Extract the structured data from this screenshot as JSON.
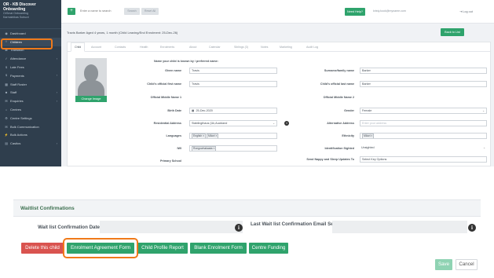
{
  "sidebar": {
    "org_name": "OR - KB Discover Onboarding",
    "org_sub": "OrSmal Onboarding\nKarmalnikas Subscri",
    "items": [
      {
        "icon": "dashboard-icon",
        "glyph": "◉",
        "label": "Dashboard",
        "chevron": ""
      },
      {
        "icon": "children-icon",
        "glyph": "☺",
        "label": "Children",
        "chevron": ""
      },
      {
        "icon": "transition-icon",
        "glyph": "⇄",
        "label": "Transition",
        "chevron": ""
      },
      {
        "icon": "attendance-icon",
        "glyph": "✓",
        "label": "Attendance",
        "chevron": "‹"
      },
      {
        "icon": "late-fees-icon",
        "glyph": "$",
        "label": "Late Fees",
        "chevron": ""
      },
      {
        "icon": "payments-icon",
        "glyph": "$",
        "label": "Payments",
        "chevron": "‹"
      },
      {
        "icon": "staff-roster-icon",
        "glyph": "▦",
        "label": "Staff Roster",
        "chevron": ""
      },
      {
        "icon": "staff-icon",
        "glyph": "☻",
        "label": "Staff",
        "chevron": "‹"
      },
      {
        "icon": "enquiries-icon",
        "glyph": "✉",
        "label": "Enquiries",
        "chevron": "‹"
      },
      {
        "icon": "centres-icon",
        "glyph": "⌂",
        "label": "Centres",
        "chevron": ""
      },
      {
        "icon": "centre-settings-icon",
        "glyph": "⚙",
        "label": "Centre Settings",
        "chevron": ""
      },
      {
        "icon": "bulk-communication-icon",
        "glyph": "✉",
        "label": "Bulk Communication",
        "chevron": ""
      },
      {
        "icon": "bulk-actions-icon",
        "glyph": "⚡",
        "label": "Bulk Actions",
        "chevron": ""
      },
      {
        "icon": "casitos-icon",
        "glyph": "▤",
        "label": "Casitos",
        "chevron": "‹"
      }
    ]
  },
  "topbar": {
    "add_label": "+",
    "search_placeholder": "Enter a name to search",
    "search_btn": "Search",
    "reset_btn": "Reset All",
    "need_help": "Need Help?",
    "email": "kristy.kook@myname.com",
    "logout": "⇥ Log out"
  },
  "breadcrumb": "Travis Barker Aged 4 years, 1 month (Child Leaving/End Enrolment: 25-Dec-26)",
  "back_to_list": "Back to List",
  "tabs": [
    "Child",
    "Account",
    "Contacts",
    "Health",
    "Enrolments",
    "About",
    "Calendar",
    "Siblings (3)",
    "Notes",
    "Marketing",
    "Audit Log"
  ],
  "form": {
    "known_by_label": "Name your child is known by / preferred name:",
    "change_image": "Change Image",
    "given_name_label": "Given name",
    "given_name": "Travis",
    "surname_label": "Surname/family name",
    "surname": "Barker",
    "official_first_label": "Child's official first name",
    "official_first": "Travis",
    "official_last_label": "Child's official last name",
    "official_last": "Barker",
    "middle1_label": "Official Middle Name 1",
    "middle2_label": "Official Middle Name 2",
    "birth_label": "Birth Date",
    "birth_date": "25-Dec-2020",
    "gender_label": "Gender",
    "gender": "Female",
    "residential_label": "Residential Address",
    "residential": "Stablingthaus (Uk,Auckland",
    "alt_address_label": "Alternative Address",
    "alt_address_placeholder": "Enter your address",
    "languages_label": "Languages",
    "languages": [
      "English ×",
      "Māori ×"
    ],
    "ethnicity_label": "Ethnicity",
    "ethnicity": [
      "Māori ×"
    ],
    "iwi_label": "IWI",
    "iwi": [
      "Rongowhakaata ×"
    ],
    "ident_label": "Identification Sighted",
    "ident": "Unsighted",
    "primary_label": "Primary School",
    "nappy_label": "Send Nappy and Sleep Updates To",
    "nappy": "Select Key Options"
  },
  "waitlist": {
    "title": "Waitlist Confirmations",
    "wait_date_label": "Wait list Confirmation Date",
    "last_sent_label": "Last Wait list Confirmation Email Sent",
    "info_glyph": "i"
  },
  "actions": {
    "delete": "Delete this child",
    "enrolment_form": "Enrolment Agreement Form",
    "profile_report": "Child Profile Report",
    "blank_form": "Blank Enrolment Form",
    "centre_funding": "Centre Funding",
    "save": "Save",
    "cancel": "Cancel"
  },
  "colors": {
    "primary_green": "#2fa36c",
    "danger_red": "#d9534f",
    "highlight_orange": "#f07a1a",
    "sidebar_bg": "#2f3e4d"
  }
}
